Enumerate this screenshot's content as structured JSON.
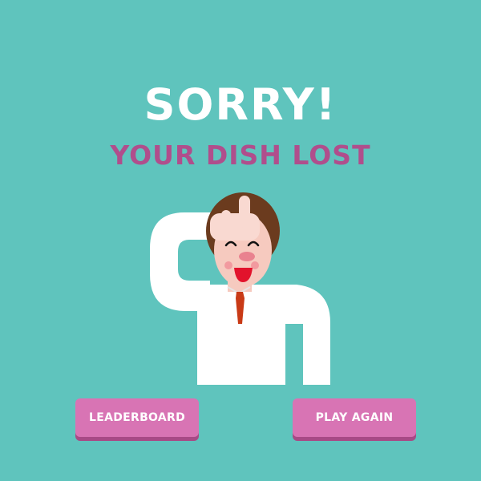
{
  "screen": {
    "title": "SORRY!",
    "subtitle": "YOUR DISH LOST"
  },
  "buttons": {
    "leaderboard_label": "LEADERBOARD",
    "play_again_label": "PLAY AGAIN"
  },
  "colors": {
    "background": "#5fc4bd",
    "title": "#ffffff",
    "subtitle": "#b04e8c",
    "button": "#d874b4",
    "button_shadow": "#a84a86"
  },
  "illustration": {
    "name": "loser-gesture-character"
  }
}
